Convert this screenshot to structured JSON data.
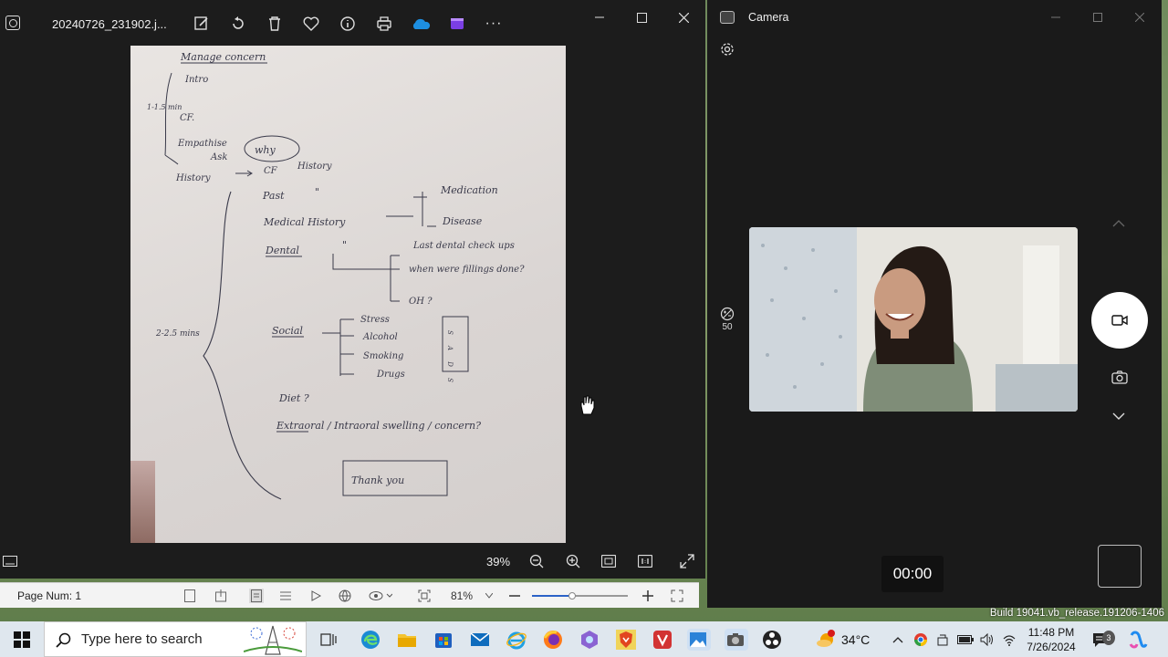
{
  "photos_window": {
    "filename": "20240726_231902.j...",
    "toolbar_icons": [
      "edit-icon",
      "rotate-icon",
      "delete-icon",
      "favorite-icon",
      "info-icon",
      "print-icon",
      "onedrive-icon",
      "clipchamp-icon",
      "more-icon"
    ],
    "more_label": "···",
    "zoom": "39%",
    "note": {
      "lines": [
        "Manage concern",
        "Intro",
        "1-1.5 min",
        "CF.",
        "Empathise",
        "Ask",
        "why",
        "History",
        "CF",
        "History",
        "Past",
        "\"",
        "Medical  History",
        "Medication",
        "Disease",
        "Dental",
        "\"",
        "Last dental check ups",
        "when were fillings done?",
        "OH ?",
        "Social",
        "Stress",
        "Alcohol",
        "Smoking",
        "Drugs",
        "S A D S",
        "2-2.5 mins",
        "Diet ?",
        "Extraoral / Intraoral swelling / concern?",
        "Thank you"
      ]
    }
  },
  "pdf_viewer": {
    "page_num": "Page Num: 1",
    "zoom": "81%"
  },
  "camera_window": {
    "title": "Camera",
    "brightness_value": "50",
    "timer": "00:00"
  },
  "build_text": "Build 19041.vb_release.191206-1406",
  "taskbar": {
    "search_placeholder": "Type here to search",
    "weather": "34°C",
    "time": "11:48 PM",
    "date": "7/26/2024",
    "notification_count": "3"
  },
  "colors": {
    "window_bg": "#1c1c1c",
    "camera_bg": "#1a1a1a",
    "taskbar_bg": "#dfe7ee",
    "paper": "#e3dfdc",
    "ink": "#3a3a4a"
  }
}
